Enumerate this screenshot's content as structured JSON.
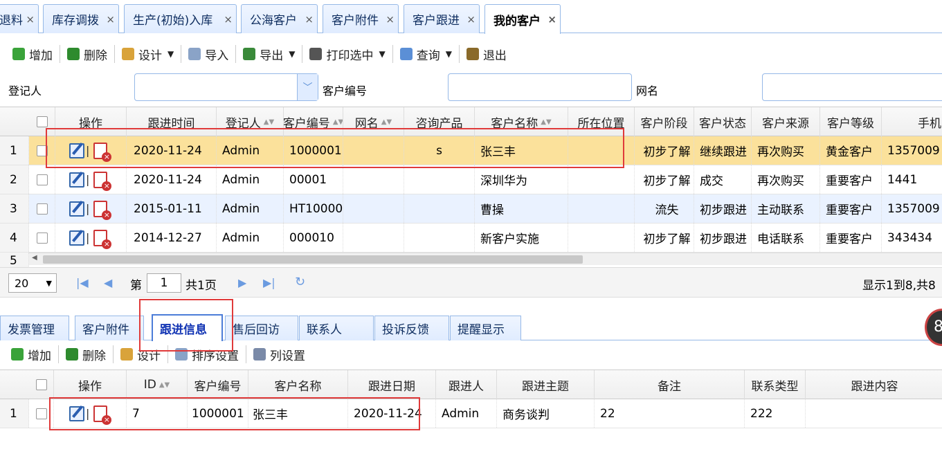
{
  "tabs": [
    {
      "label": "退料",
      "active": false
    },
    {
      "label": "库存调拨",
      "active": false
    },
    {
      "label": "生产(初始)入库",
      "active": false
    },
    {
      "label": "公海客户",
      "active": false
    },
    {
      "label": "客户附件",
      "active": false
    },
    {
      "label": "客户跟进",
      "active": false
    },
    {
      "label": "我的客户",
      "active": true
    }
  ],
  "close_glyph": "×",
  "toolbar": [
    {
      "label": "增加",
      "icon": "add-icon",
      "color": "#3aa33a"
    },
    {
      "label": "删除",
      "icon": "delete-icon",
      "color": "#2e8b2e"
    },
    {
      "label": "设计",
      "icon": "design-icon",
      "color": "#d9a33a",
      "caret": true
    },
    {
      "label": "导入",
      "icon": "import-icon",
      "color": "#8aa3c7"
    },
    {
      "label": "导出",
      "icon": "export-icon",
      "color": "#3a8a3a",
      "caret": true
    },
    {
      "label": "打印选中",
      "icon": "print-icon",
      "color": "#555",
      "caret": true
    },
    {
      "label": "查询",
      "icon": "search-icon",
      "color": "#5b8fd6",
      "caret": true
    },
    {
      "label": "退出",
      "icon": "exit-icon",
      "color": "#8a6a2a"
    }
  ],
  "filters": {
    "registrant": "登记人",
    "customer_no": "客户编号",
    "net_name": "网名"
  },
  "grid": {
    "columns": [
      "",
      "操作",
      "跟进时间",
      "登记人",
      "客户编号",
      "网名",
      "咨询产品",
      "客户名称",
      "所在位置",
      "客户阶段",
      "客户状态",
      "客户来源",
      "客户等级",
      "手机"
    ],
    "rows": [
      {
        "no": "1",
        "time": "2020-11-24",
        "reg": "Admin",
        "code": "1000001",
        "net": "",
        "product": "s",
        "name": "张三丰",
        "loc": "",
        "stage": "初步了解",
        "status": "继续跟进",
        "source": "再次购买",
        "level": "黄金客户",
        "phone": "1357009"
      },
      {
        "no": "2",
        "time": "2020-11-24",
        "reg": "Admin",
        "code": "00001",
        "net": "",
        "product": "",
        "name": "深圳华为",
        "loc": "",
        "stage": "初步了解",
        "status": "成交",
        "source": "再次购买",
        "level": "重要客户",
        "phone": "1441"
      },
      {
        "no": "3",
        "time": "2015-01-11",
        "reg": "Admin",
        "code": "HT10000",
        "net": "",
        "product": "",
        "name": "曹操",
        "loc": "",
        "stage": "流失",
        "status": "初步跟进",
        "source": "主动联系",
        "level": "重要客户",
        "phone": "1357009"
      },
      {
        "no": "4",
        "time": "2014-12-27",
        "reg": "Admin",
        "code": "000010",
        "net": "",
        "product": "",
        "name": "新客户实施",
        "loc": "",
        "stage": "初步了解",
        "status": "初步跟进",
        "source": "电话联系",
        "level": "重要客户",
        "phone": "343434"
      }
    ],
    "partial_row_no": "5"
  },
  "pager": {
    "page_size": "20",
    "page_label_pre": "第",
    "page": "1",
    "page_label_post": "共1页",
    "summary": "显示1到8,共8"
  },
  "bottom_tabs": [
    {
      "label": "发票管理",
      "active": false
    },
    {
      "label": "客户附件",
      "active": false
    },
    {
      "label": "跟进信息",
      "active": true
    },
    {
      "label": "售后回访",
      "active": false
    },
    {
      "label": "联系人",
      "active": false
    },
    {
      "label": "投诉反馈",
      "active": false
    },
    {
      "label": "提醒显示",
      "active": false
    }
  ],
  "bottom_toolbar": [
    {
      "label": "增加",
      "icon": "add-icon",
      "color": "#3aa33a"
    },
    {
      "label": "删除",
      "icon": "delete-icon",
      "color": "#2e8b2e"
    },
    {
      "label": "设计",
      "icon": "design-icon",
      "color": "#d9a33a"
    },
    {
      "label": "排序设置",
      "icon": "sort-icon",
      "color": "#8aa3c7"
    },
    {
      "label": "列设置",
      "icon": "wrench-icon",
      "color": "#7a8aa8"
    }
  ],
  "sub_grid": {
    "columns": [
      "",
      "操作",
      "ID",
      "客户编号",
      "客户名称",
      "跟进日期",
      "跟进人",
      "跟进主题",
      "备注",
      "联系类型",
      "跟进内容"
    ],
    "rows": [
      {
        "no": "1",
        "id": "7",
        "code": "1000001",
        "name": "张三丰",
        "date": "2020-11-24",
        "person": "Admin",
        "topic": "商务谈判",
        "note": "22",
        "ctype": "222",
        "content": ""
      }
    ]
  },
  "badge": "8"
}
